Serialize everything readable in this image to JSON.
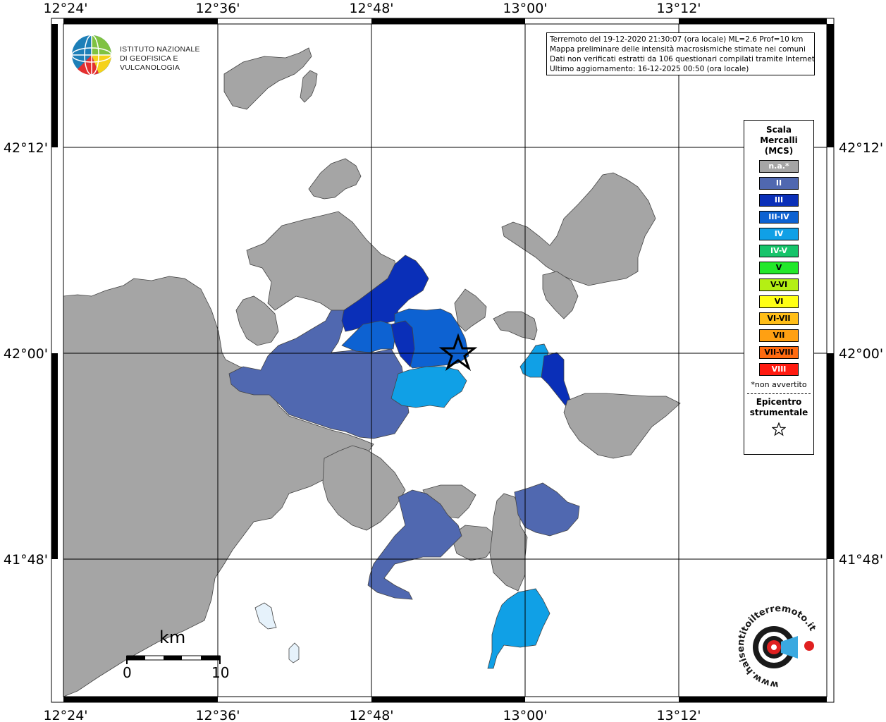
{
  "map": {
    "lon_labels": [
      "12°24'",
      "12°36'",
      "12°48'",
      "13°00'",
      "13°12'"
    ],
    "lat_labels": [
      "42°12'",
      "42°00'",
      "41°48'"
    ]
  },
  "info_box": {
    "lines": [
      "Terremoto del 19-12-2020 21:30:07 (ora locale) ML=2.6 Prof=10 km",
      "Mappa preliminare delle intensità macrosismiche stimate nei comuni",
      "Dati non verificati estratti da 106 questionari compilati tramite Internet.",
      "Ultimo aggiornamento: 16-12-2025 00:50 (ora locale)"
    ]
  },
  "legend": {
    "title_lines": [
      "Scala",
      "Mercalli",
      "(MCS)"
    ],
    "items": [
      {
        "label": "n.a.*",
        "color": "#a5a5a5"
      },
      {
        "label": "II",
        "color": "#5068b0"
      },
      {
        "label": "III",
        "color": "#0a2fb8"
      },
      {
        "label": "III-IV",
        "color": "#0d62d2"
      },
      {
        "label": "IV",
        "color": "#10a0e6"
      },
      {
        "label": "IV-V",
        "color": "#16c46a"
      },
      {
        "label": "V",
        "color": "#22e82a"
      },
      {
        "label": "V-VI",
        "color": "#b4ef14"
      },
      {
        "label": "VI",
        "color": "#ffff14"
      },
      {
        "label": "VI-VII",
        "color": "#ffbe18"
      },
      {
        "label": "VII",
        "color": "#ffa012"
      },
      {
        "label": "VII-VIII",
        "color": "#ff6a10"
      },
      {
        "label": "VIII",
        "color": "#ff1a10"
      }
    ],
    "note": "*non avvertito",
    "epicenter_lines": [
      "Epicentro",
      "strumentale"
    ]
  },
  "logo_ingv": {
    "line1": "ISTITUTO NAZIONALE",
    "line2": "DI GEOFISICA E VULCANOLOGIA"
  },
  "logo_hsit": {
    "text": "www.haisentitoilterremoto.it"
  },
  "scalebar": {
    "unit": "km",
    "start": "0",
    "end": "10"
  },
  "colors": {
    "land": "#a5a5a5",
    "lake": "#e6f2fb",
    "border": "#000000"
  }
}
